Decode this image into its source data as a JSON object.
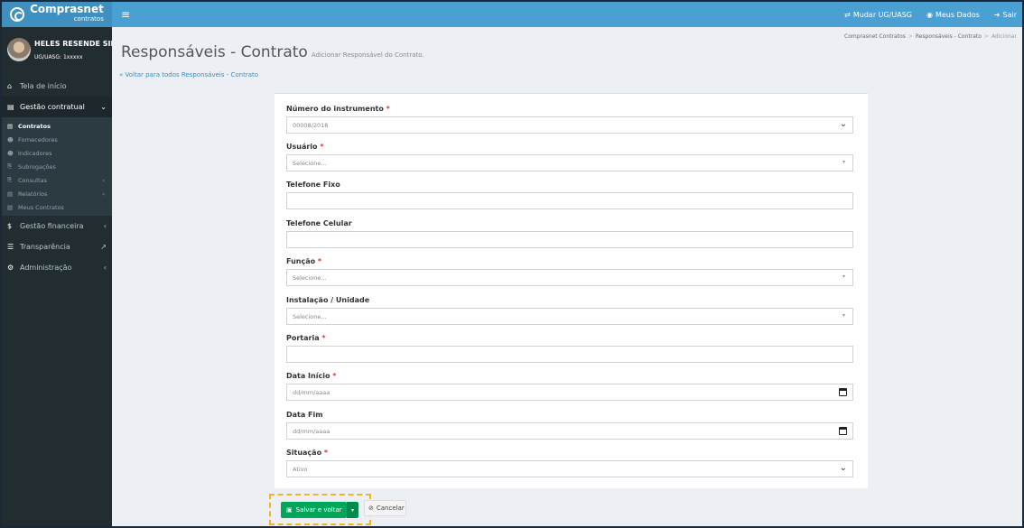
{
  "brand": {
    "name": "Comprasnet",
    "sub": "contratos"
  },
  "topbar": {
    "menu_icon": "hamburger-icon",
    "change_ug": "Mudar UG/UASG",
    "my_data": "Meus Dados",
    "logout": "Sair"
  },
  "user": {
    "name": "HELES RESENDE SILVA...",
    "uasg": "UG/UASG: 1xxxxx"
  },
  "sidebar": {
    "home": "Tela de início",
    "contract_mgmt": "Gestão contratual",
    "sub": [
      {
        "label": "Contratos"
      },
      {
        "label": "Fornecedores"
      },
      {
        "label": "Indicadores"
      },
      {
        "label": "Subrogações"
      },
      {
        "label": "Consultas"
      },
      {
        "label": "Relatórios"
      },
      {
        "label": "Meus Contratos"
      }
    ],
    "financial": "Gestão financeira",
    "transparency": "Transparência",
    "admin": "Administração"
  },
  "page": {
    "title": "Responsáveis - Contrato",
    "subtitle": "Adicionar Responsável do Contrato.",
    "back_link": "« Voltar para todos Responsáveis - Contrato",
    "breadcrumb": [
      "Comprasnet Contratos",
      "Responsáveis - Contrato",
      "Adicionar"
    ]
  },
  "form": {
    "instrument": {
      "label": "Número do instrumento",
      "value": "00008/2018"
    },
    "user": {
      "label": "Usuário",
      "value": "Selecione..."
    },
    "phone": {
      "label": "Telefone Fixo"
    },
    "mobile": {
      "label": "Telefone Celular"
    },
    "role": {
      "label": "Função",
      "value": "Selecione..."
    },
    "unit": {
      "label": "Instalação / Unidade",
      "value": "Selecione..."
    },
    "ordinance": {
      "label": "Portaria"
    },
    "start": {
      "label": "Data Início",
      "placeholder": "dd/mm/aaaa"
    },
    "end": {
      "label": "Data Fim",
      "placeholder": "dd/mm/aaaa"
    },
    "status": {
      "label": "Situação",
      "value": "Ativo"
    },
    "required_mark": "*"
  },
  "buttons": {
    "save": "Salvar e voltar",
    "cancel": "Cancelar"
  }
}
